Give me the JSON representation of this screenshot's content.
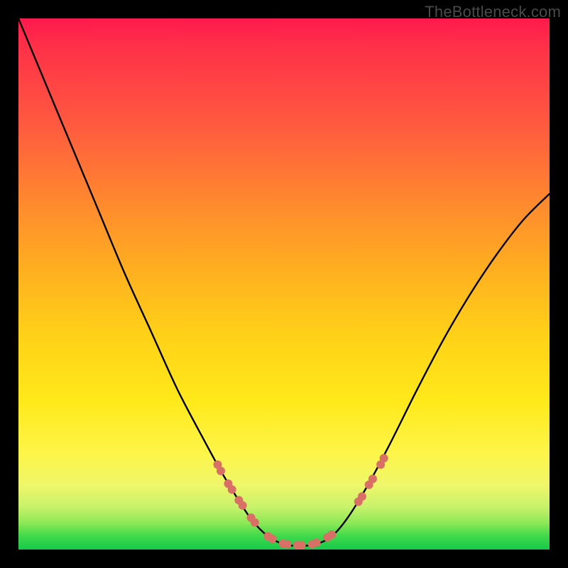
{
  "watermark": "TheBottleneck.com",
  "chart_data": {
    "type": "line",
    "title": "",
    "xlabel": "",
    "ylabel": "",
    "xlim": [
      0,
      1
    ],
    "ylim": [
      0,
      1
    ],
    "series": [
      {
        "name": "bottleneck-curve",
        "x": [
          0.0,
          0.05,
          0.1,
          0.15,
          0.2,
          0.25,
          0.3,
          0.35,
          0.38,
          0.41,
          0.44,
          0.47,
          0.5,
          0.53,
          0.56,
          0.59,
          0.62,
          0.66,
          0.7,
          0.75,
          0.8,
          0.85,
          0.9,
          0.95,
          1.0
        ],
        "y": [
          1.0,
          0.88,
          0.76,
          0.64,
          0.52,
          0.41,
          0.3,
          0.205,
          0.15,
          0.1,
          0.055,
          0.025,
          0.01,
          0.007,
          0.01,
          0.025,
          0.06,
          0.125,
          0.2,
          0.3,
          0.395,
          0.48,
          0.555,
          0.62,
          0.67
        ]
      }
    ],
    "markers": {
      "name": "highlight-dots",
      "color": "#d87066",
      "points": [
        {
          "x": 0.375,
          "y": 0.16
        },
        {
          "x": 0.381,
          "y": 0.148
        },
        {
          "x": 0.395,
          "y": 0.124
        },
        {
          "x": 0.402,
          "y": 0.113
        },
        {
          "x": 0.415,
          "y": 0.093
        },
        {
          "x": 0.422,
          "y": 0.083
        },
        {
          "x": 0.438,
          "y": 0.06
        },
        {
          "x": 0.445,
          "y": 0.051
        },
        {
          "x": 0.47,
          "y": 0.025
        },
        {
          "x": 0.478,
          "y": 0.02
        },
        {
          "x": 0.498,
          "y": 0.011
        },
        {
          "x": 0.506,
          "y": 0.01
        },
        {
          "x": 0.525,
          "y": 0.008
        },
        {
          "x": 0.533,
          "y": 0.008
        },
        {
          "x": 0.553,
          "y": 0.01
        },
        {
          "x": 0.561,
          "y": 0.013
        },
        {
          "x": 0.582,
          "y": 0.023
        },
        {
          "x": 0.59,
          "y": 0.028
        },
        {
          "x": 0.64,
          "y": 0.09
        },
        {
          "x": 0.647,
          "y": 0.1
        },
        {
          "x": 0.66,
          "y": 0.122
        },
        {
          "x": 0.667,
          "y": 0.133
        },
        {
          "x": 0.682,
          "y": 0.16
        },
        {
          "x": 0.688,
          "y": 0.172
        }
      ]
    }
  }
}
